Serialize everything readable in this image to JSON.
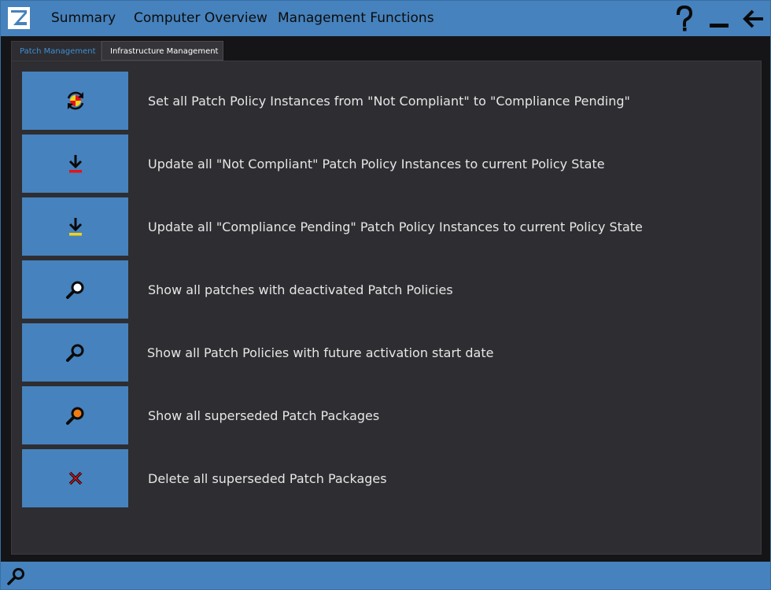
{
  "header": {
    "menu": [
      "Summary",
      "Computer Overview",
      "Management Functions"
    ],
    "icons": [
      "app-logo-icon",
      "help-icon",
      "minimize-icon",
      "back-arrow-icon"
    ]
  },
  "tabs": [
    {
      "label": "Patch Management",
      "active": true
    },
    {
      "label": "Infrastructure Management",
      "active": false
    }
  ],
  "actions": [
    {
      "label": "Set all Patch Policy Instances from \"Not Compliant\" to \"Compliance Pending\"",
      "icon": "refresh-cycle-icon"
    },
    {
      "label": "Update all \"Not Compliant\" Patch Policy Instances to current Policy State",
      "icon": "download-red-icon"
    },
    {
      "label": "Update all \"Compliance Pending\" Patch Policy Instances to current Policy State",
      "icon": "download-yellow-icon"
    },
    {
      "label": "Show all patches with deactivated Patch Policies",
      "icon": "search-white-icon"
    },
    {
      "label": "Show all Patch Policies with future activation start date",
      "icon": "search-blue-icon"
    },
    {
      "label": "Show all superseded Patch Packages",
      "icon": "search-orange-icon"
    },
    {
      "label": "Delete all superseded Patch Packages",
      "icon": "delete-x-icon"
    }
  ],
  "colors": {
    "accent": "#4682bd",
    "panel": "#2e2d31",
    "background": "#151517",
    "active_tab_text": "#3d8fd6",
    "red": "#e3141b",
    "yellow": "#f2d21b",
    "orange": "#f07b12"
  },
  "statusbar": {
    "icon": "search-icon"
  }
}
